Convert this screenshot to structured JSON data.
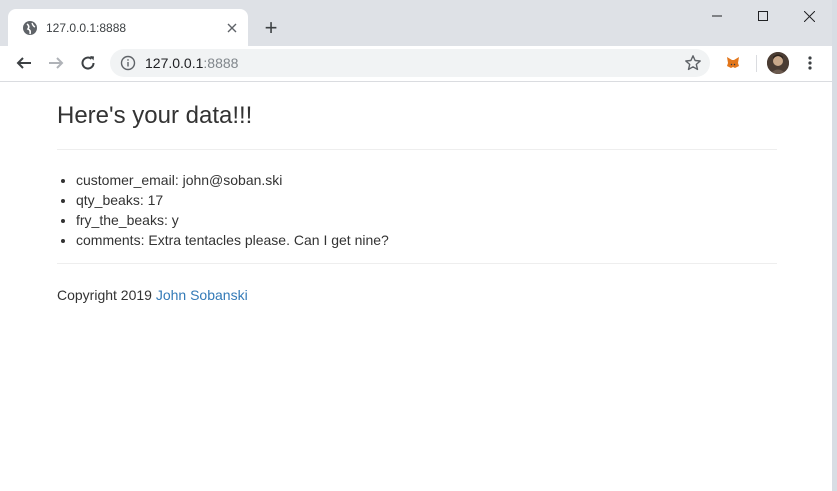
{
  "browser": {
    "tab": {
      "title": "127.0.0.1:8888",
      "favicon": "globe-icon"
    },
    "new_tab_symbol": "+",
    "window_controls": [
      "minimize-icon",
      "maximize-icon",
      "close-icon"
    ],
    "omnibox": {
      "host": "127.0.0.1",
      "port": ":8888"
    },
    "toolbar_icons": [
      "back-icon",
      "forward-icon",
      "reload-icon",
      "info-icon",
      "star-icon",
      "metamask-fox-icon",
      "avatar",
      "menu-icon"
    ]
  },
  "page": {
    "heading": "Here's your data!!!",
    "items": [
      "customer_email: john@soban.ski",
      "qty_beaks: 17",
      "fry_the_beaks: y",
      "comments: Extra tentacles please. Can I get nine?"
    ],
    "footer": {
      "text": "Copyright 2019 ",
      "link_text": "John Sobanski"
    }
  },
  "colors": {
    "titlebar": "#dee1e6",
    "link": "#337ab7",
    "text": "#333333",
    "metamask": "#e2761b"
  }
}
